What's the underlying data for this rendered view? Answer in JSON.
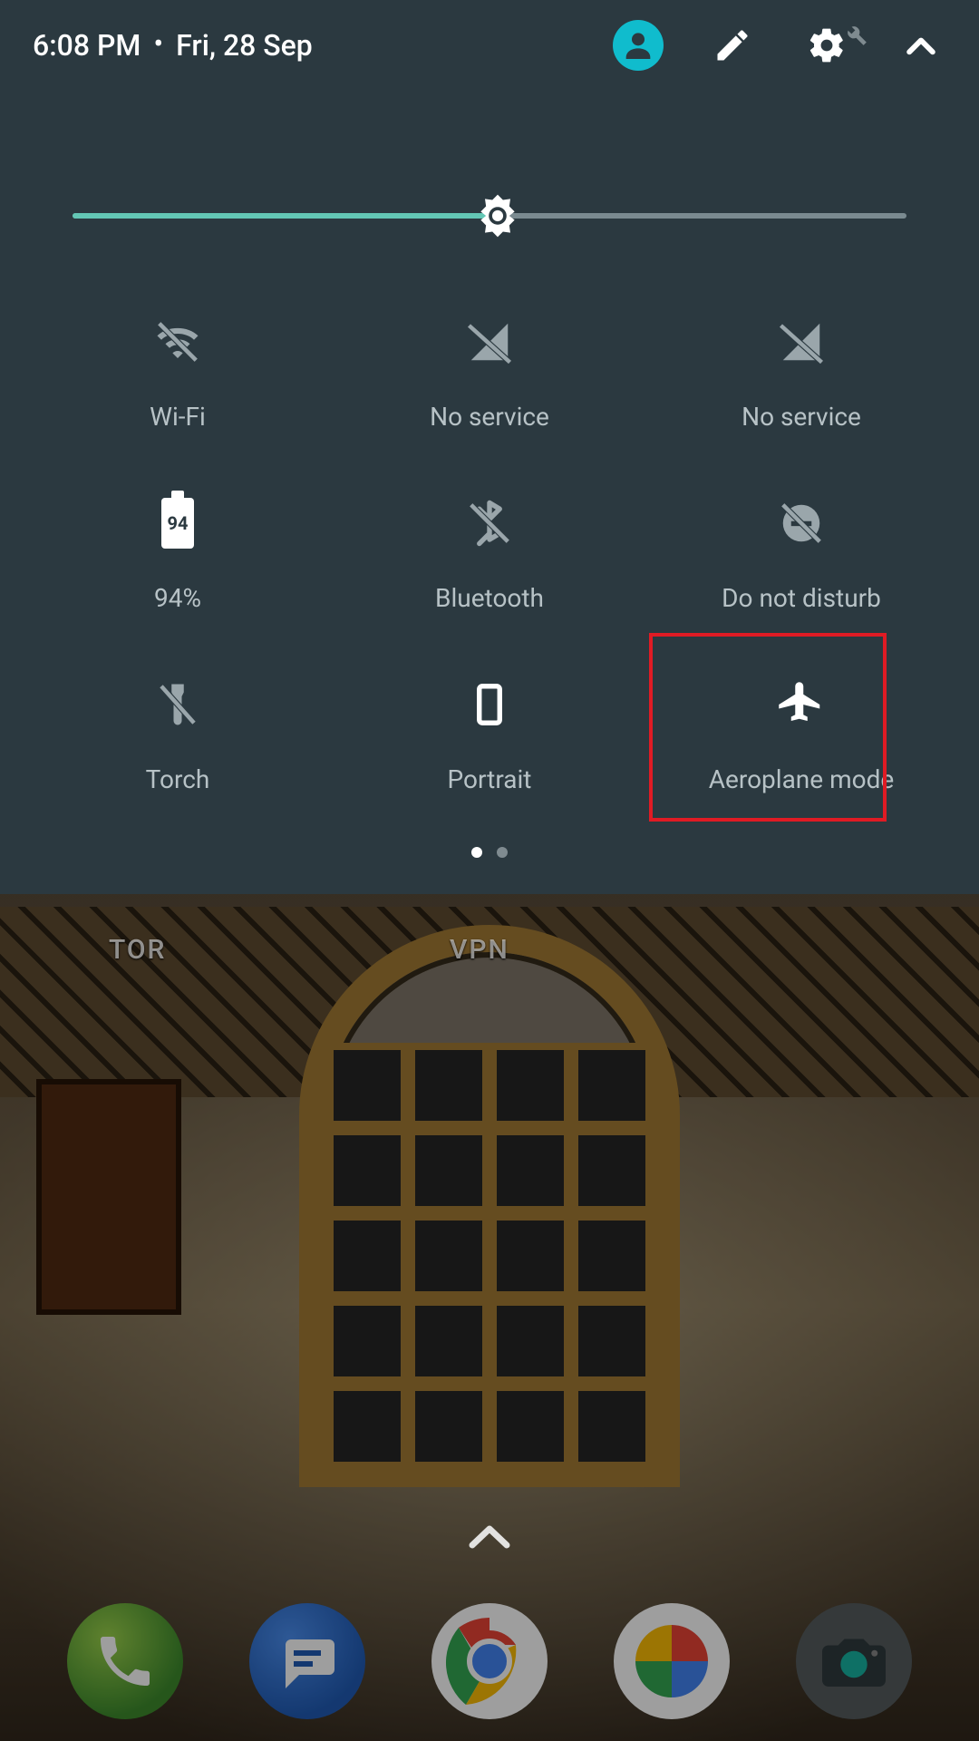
{
  "header": {
    "time": "6:08 PM",
    "date": "Fri, 28 Sep"
  },
  "brightness": {
    "percent": 51
  },
  "tiles": [
    {
      "key": "wifi",
      "label": "Wi-Fi",
      "active": false,
      "icon": "wifi-off"
    },
    {
      "key": "sim1",
      "label": "No service",
      "active": false,
      "icon": "signal-off"
    },
    {
      "key": "sim2",
      "label": "No service",
      "active": false,
      "icon": "signal-off"
    },
    {
      "key": "battery",
      "label": "94%",
      "active": true,
      "icon": "battery",
      "battery_text": "94"
    },
    {
      "key": "bluetooth",
      "label": "Bluetooth",
      "active": false,
      "icon": "bluetooth-off"
    },
    {
      "key": "dnd",
      "label": "Do not disturb",
      "active": false,
      "icon": "dnd-off"
    },
    {
      "key": "torch",
      "label": "Torch",
      "active": false,
      "icon": "torch-off"
    },
    {
      "key": "rotation",
      "label": "Portrait",
      "active": true,
      "icon": "portrait"
    },
    {
      "key": "airplane",
      "label": "Aeroplane mode",
      "active": true,
      "icon": "airplane"
    }
  ],
  "pages": {
    "count": 2,
    "current": 0
  },
  "home": {
    "shortcut_labels": {
      "tor": "TOR",
      "vpn": "VPN"
    }
  },
  "highlight": {
    "tile_key": "airplane"
  }
}
